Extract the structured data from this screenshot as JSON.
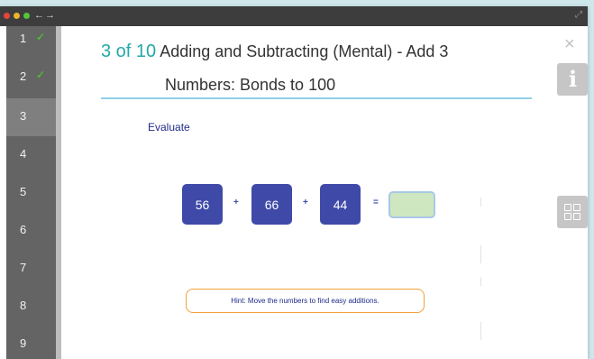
{
  "window": {
    "nav_back": "←",
    "nav_forward": "→",
    "expand": "⤢"
  },
  "sidebar": {
    "items": [
      {
        "label": "1",
        "done": true,
        "active": false
      },
      {
        "label": "2",
        "done": true,
        "active": false
      },
      {
        "label": "3",
        "done": false,
        "active": true
      },
      {
        "label": "4",
        "done": false,
        "active": false
      },
      {
        "label": "5",
        "done": false,
        "active": false
      },
      {
        "label": "6",
        "done": false,
        "active": false
      },
      {
        "label": "7",
        "done": false,
        "active": false
      },
      {
        "label": "8",
        "done": false,
        "active": false
      },
      {
        "label": "9",
        "done": false,
        "active": false
      }
    ],
    "check_glyph": "✓"
  },
  "header": {
    "progress": "3 of 10",
    "title_line1": "Adding and Subtracting (Mental) - Add 3",
    "title_line2": "Numbers: Bonds to 100"
  },
  "controls": {
    "close": "×",
    "info": "i"
  },
  "question": {
    "instruction": "Evaluate",
    "numbers": [
      "56",
      "66",
      "44"
    ],
    "operators": [
      "+",
      "+",
      "="
    ],
    "answer": ""
  },
  "hint": "Hint: Move the numbers to find easy additions.",
  "colors": {
    "tile": "#3f4aa8",
    "progress": "#23a8a8",
    "check": "#4fb636",
    "hint_border": "#f0a23a",
    "answer_fill": "#cfe7c0"
  }
}
